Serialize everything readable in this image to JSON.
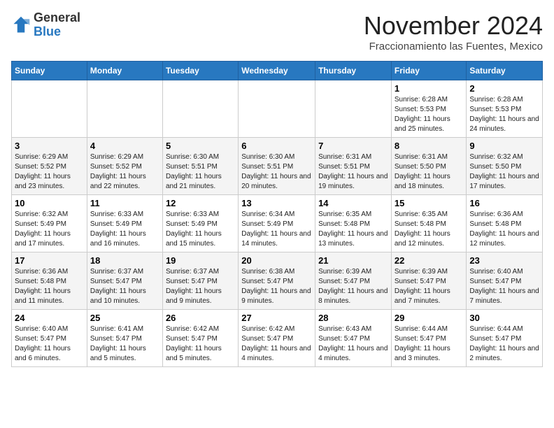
{
  "header": {
    "logo_general": "General",
    "logo_blue": "Blue",
    "month": "November 2024",
    "location": "Fraccionamiento las Fuentes, Mexico"
  },
  "days_of_week": [
    "Sunday",
    "Monday",
    "Tuesday",
    "Wednesday",
    "Thursday",
    "Friday",
    "Saturday"
  ],
  "weeks": [
    [
      {
        "day": "",
        "text": ""
      },
      {
        "day": "",
        "text": ""
      },
      {
        "day": "",
        "text": ""
      },
      {
        "day": "",
        "text": ""
      },
      {
        "day": "",
        "text": ""
      },
      {
        "day": "1",
        "text": "Sunrise: 6:28 AM\nSunset: 5:53 PM\nDaylight: 11 hours and 25 minutes."
      },
      {
        "day": "2",
        "text": "Sunrise: 6:28 AM\nSunset: 5:53 PM\nDaylight: 11 hours and 24 minutes."
      }
    ],
    [
      {
        "day": "3",
        "text": "Sunrise: 6:29 AM\nSunset: 5:52 PM\nDaylight: 11 hours and 23 minutes."
      },
      {
        "day": "4",
        "text": "Sunrise: 6:29 AM\nSunset: 5:52 PM\nDaylight: 11 hours and 22 minutes."
      },
      {
        "day": "5",
        "text": "Sunrise: 6:30 AM\nSunset: 5:51 PM\nDaylight: 11 hours and 21 minutes."
      },
      {
        "day": "6",
        "text": "Sunrise: 6:30 AM\nSunset: 5:51 PM\nDaylight: 11 hours and 20 minutes."
      },
      {
        "day": "7",
        "text": "Sunrise: 6:31 AM\nSunset: 5:51 PM\nDaylight: 11 hours and 19 minutes."
      },
      {
        "day": "8",
        "text": "Sunrise: 6:31 AM\nSunset: 5:50 PM\nDaylight: 11 hours and 18 minutes."
      },
      {
        "day": "9",
        "text": "Sunrise: 6:32 AM\nSunset: 5:50 PM\nDaylight: 11 hours and 17 minutes."
      }
    ],
    [
      {
        "day": "10",
        "text": "Sunrise: 6:32 AM\nSunset: 5:49 PM\nDaylight: 11 hours and 17 minutes."
      },
      {
        "day": "11",
        "text": "Sunrise: 6:33 AM\nSunset: 5:49 PM\nDaylight: 11 hours and 16 minutes."
      },
      {
        "day": "12",
        "text": "Sunrise: 6:33 AM\nSunset: 5:49 PM\nDaylight: 11 hours and 15 minutes."
      },
      {
        "day": "13",
        "text": "Sunrise: 6:34 AM\nSunset: 5:49 PM\nDaylight: 11 hours and 14 minutes."
      },
      {
        "day": "14",
        "text": "Sunrise: 6:35 AM\nSunset: 5:48 PM\nDaylight: 11 hours and 13 minutes."
      },
      {
        "day": "15",
        "text": "Sunrise: 6:35 AM\nSunset: 5:48 PM\nDaylight: 11 hours and 12 minutes."
      },
      {
        "day": "16",
        "text": "Sunrise: 6:36 AM\nSunset: 5:48 PM\nDaylight: 11 hours and 12 minutes."
      }
    ],
    [
      {
        "day": "17",
        "text": "Sunrise: 6:36 AM\nSunset: 5:48 PM\nDaylight: 11 hours and 11 minutes."
      },
      {
        "day": "18",
        "text": "Sunrise: 6:37 AM\nSunset: 5:47 PM\nDaylight: 11 hours and 10 minutes."
      },
      {
        "day": "19",
        "text": "Sunrise: 6:37 AM\nSunset: 5:47 PM\nDaylight: 11 hours and 9 minutes."
      },
      {
        "day": "20",
        "text": "Sunrise: 6:38 AM\nSunset: 5:47 PM\nDaylight: 11 hours and 9 minutes."
      },
      {
        "day": "21",
        "text": "Sunrise: 6:39 AM\nSunset: 5:47 PM\nDaylight: 11 hours and 8 minutes."
      },
      {
        "day": "22",
        "text": "Sunrise: 6:39 AM\nSunset: 5:47 PM\nDaylight: 11 hours and 7 minutes."
      },
      {
        "day": "23",
        "text": "Sunrise: 6:40 AM\nSunset: 5:47 PM\nDaylight: 11 hours and 7 minutes."
      }
    ],
    [
      {
        "day": "24",
        "text": "Sunrise: 6:40 AM\nSunset: 5:47 PM\nDaylight: 11 hours and 6 minutes."
      },
      {
        "day": "25",
        "text": "Sunrise: 6:41 AM\nSunset: 5:47 PM\nDaylight: 11 hours and 5 minutes."
      },
      {
        "day": "26",
        "text": "Sunrise: 6:42 AM\nSunset: 5:47 PM\nDaylight: 11 hours and 5 minutes."
      },
      {
        "day": "27",
        "text": "Sunrise: 6:42 AM\nSunset: 5:47 PM\nDaylight: 11 hours and 4 minutes."
      },
      {
        "day": "28",
        "text": "Sunrise: 6:43 AM\nSunset: 5:47 PM\nDaylight: 11 hours and 4 minutes."
      },
      {
        "day": "29",
        "text": "Sunrise: 6:44 AM\nSunset: 5:47 PM\nDaylight: 11 hours and 3 minutes."
      },
      {
        "day": "30",
        "text": "Sunrise: 6:44 AM\nSunset: 5:47 PM\nDaylight: 11 hours and 2 minutes."
      }
    ]
  ]
}
